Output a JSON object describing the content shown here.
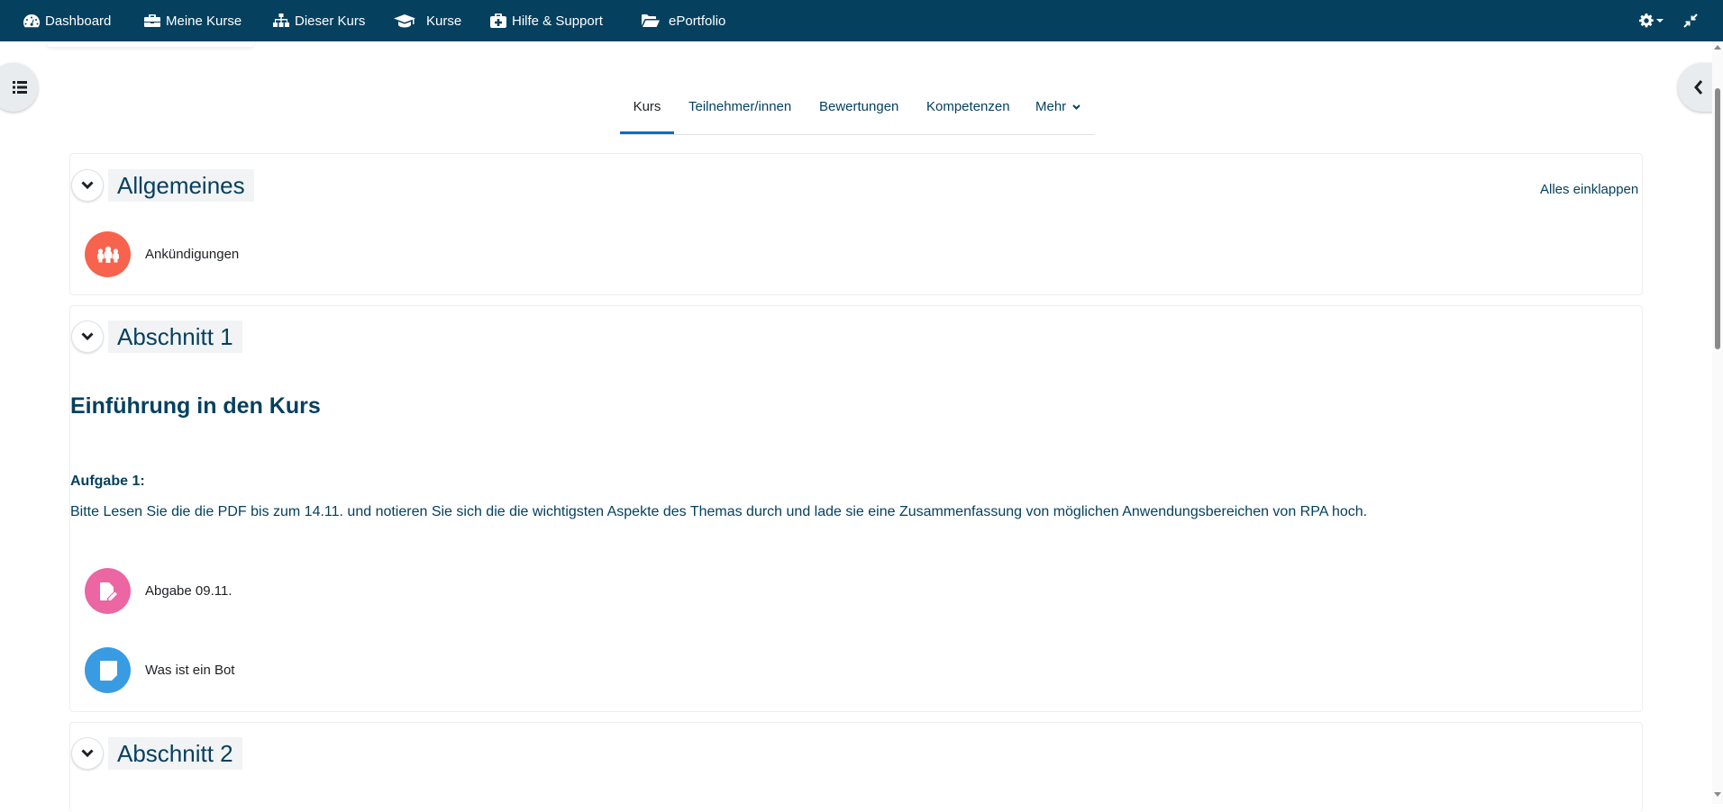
{
  "navbar": {
    "items": [
      {
        "label": "Dashboard",
        "icon": "dashboard-icon"
      },
      {
        "label": "Meine Kurse",
        "icon": "briefcase-icon"
      },
      {
        "label": "Dieser Kurs",
        "icon": "sitemap-icon"
      },
      {
        "label": "Kurse",
        "icon": "graduation-cap-icon"
      },
      {
        "label": "Hilfe & Support",
        "icon": "medkit-icon"
      },
      {
        "label": "ePortfolio",
        "icon": "folder-open-icon"
      }
    ],
    "right": {
      "settings_icon": "gear-icon",
      "collapse_icon": "compress-icon"
    }
  },
  "secondary_nav": {
    "tabs": [
      {
        "label": "Kurs",
        "active": true
      },
      {
        "label": "Teilnehmer/innen"
      },
      {
        "label": "Bewertungen"
      },
      {
        "label": "Kompetenzen"
      },
      {
        "label": "Mehr"
      }
    ]
  },
  "sections": {
    "general": {
      "title": "Allgemeines",
      "collapse_all": "Alles einklappen",
      "activities": [
        {
          "label": "Ankündigungen",
          "icon": "forum-icon",
          "color": "#f7634d"
        }
      ]
    },
    "section1": {
      "title": "Abschnitt 1",
      "heading": "Einführung in den Kurs",
      "task_label": "Aufgabe 1:",
      "task_text": "Bitte Lesen Sie die die PDF bis zum 14.11. und notieren Sie sich die die wichtigsten Aspekte des Themas durch und lade sie eine Zusammenfassung von möglichen Anwendungsbereichen von RPA hoch.",
      "activities": [
        {
          "label": "Abgabe 09.11.",
          "icon": "assignment-icon",
          "color": "#eb66a2"
        },
        {
          "label": "Was ist ein Bot",
          "icon": "page-icon",
          "color": "#399be2"
        }
      ]
    },
    "section2": {
      "title": "Abschnitt 2"
    }
  },
  "colors": {
    "navbar": "#05405f",
    "link": "#05405f",
    "accent": "#0f6cbf"
  }
}
